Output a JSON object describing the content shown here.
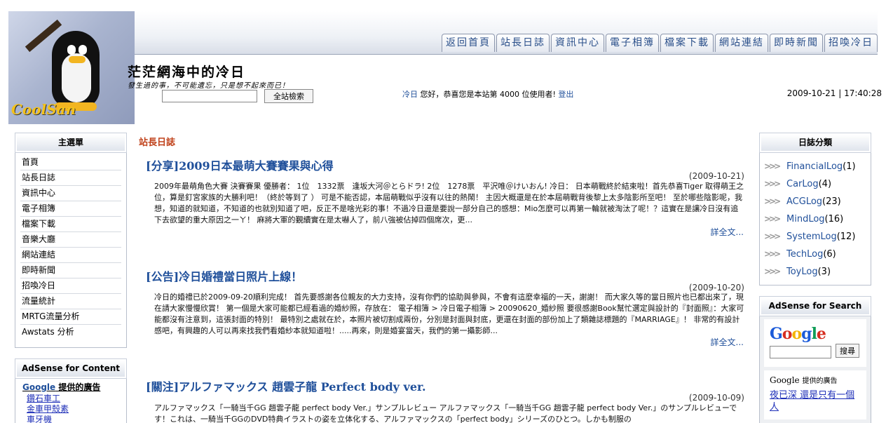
{
  "header": {
    "logo_text": "CoolSan",
    "site_title": "茫茫網海中的冷日",
    "slogan": "發生過的事，不可能遺忘，只是想不起來而已！",
    "search_button": "全站檢索",
    "greeting_user": "冷日",
    "greeting_text": "您好，恭喜您是本站第 4000 位使用者!",
    "logout": "登出",
    "datetime": "2009-10-21 | 17:40:28"
  },
  "tabs": [
    "返回首頁",
    "站長日誌",
    "資訊中心",
    "電子相簿",
    "檔案下載",
    "網站連結",
    "即時新聞",
    "招喚冷日"
  ],
  "left_menu": {
    "title": "主選單",
    "items": [
      "首頁",
      "站長日誌",
      "資訊中心",
      "電子相簿",
      "檔案下載",
      "音樂大廳",
      "網站連結",
      "即時新聞",
      "招喚冷日",
      "流量統計",
      "MRTG流量分析",
      "Awstats 分析"
    ]
  },
  "left_ads": {
    "title": "AdSense for Content",
    "provider_prefix": "Google",
    "provider_suffix": "提供的廣告",
    "links": [
      "鑽石車工",
      "金車甲殼素",
      "車牙機"
    ]
  },
  "main": {
    "section_title": "站長日誌",
    "more_label": "詳全文...",
    "posts": [
      {
        "title": "[分享]2009日本最萌大賽賽果與心得",
        "date": "(2009-10-21)",
        "body": "2009年最萌角色大賽 決賽賽果 優勝者： 1位　1332票　逢坂大河＠とらドラ! 2位　1278票　平沢唯＠けいおん! 冷日： 日本萌戰終於結束啦！首先恭喜Tiger 取得萌王之位，算是釘宮家族的大勝利吧！（終於等到了 ） 可是不能否認，本屆萌戰似乎沒有以往的熱鬧！ 主因大概還是在於本屆萌戰背後黎上太多陰影所至吧！ 至於哪些陰影呢，我想，知道的就知道，不知道的也就別知道了吧，反正不是啥光彩的事！不過冷日還是要說一部分自己的感想：Mio怎麼可以再第一輪就被淘汰了呢！？這實在是讓冷日沒有追下去欲望的重大原因之一ㄚ！ 麻將大軍的覲續實在是太嚇人了，前八強被佔掉四個席次，更..."
      },
      {
        "title": "[公告]冷日婚禮當日照片上線！",
        "date": "(2009-10-20)",
        "body": "冷日的婚禮已於2009-09-20順利完成！ 首先要感謝各位親友的大力支持，沒有你們的協助與參與，不會有這麼幸福的一天，謝謝！ 而大家久等的當日照片也已都出來了，現在請大家慢慢欣賞！ 第一個是大家可能都已經看過的婚紗照，存放在： 電子相簿 > 冷日電子相簿 > 20090620_婚紗照 要很感謝Book幫忙選定與設計的『封面照』：大家可能都沒有注意到，這張封面的特別！ 最特別之處就在於，本照片被切割成兩份，分別是封面與封底，更還在封面的部份加上了類雜誌標題的『MARRIAGE』！ 非常的有設計感吧，有興趣的人可以再來找我們看婚紗本就知道啦！.....再來，則是婚宴當天，我們的第一攝影師..."
      },
      {
        "title": "[關注]アルファマックス 趙雲子龍 Perfect body ver.",
        "date": "(2009-10-09)",
        "body": "アルファマックス「一騎当千GG 趙雲子龍 perfect body Ver.」サンプルレビュー アルファマックス「一騎当千GG 趙雲子龍 perfect body Ver.」のサンプルレビューです！これは、一騎当千GGのDVD特典イラストの姿を立体化する、アルファマックスの「perfect body」シリーズのひとつ。しかも制服の"
      }
    ]
  },
  "right_categories": {
    "title": "日誌分類",
    "items": [
      {
        "name": "FinancialLog",
        "count": "(1)"
      },
      {
        "name": "CarLog",
        "count": "(4)"
      },
      {
        "name": "ACGLog",
        "count": "(23)"
      },
      {
        "name": "MindLog",
        "count": "(16)"
      },
      {
        "name": "SystemLog",
        "count": "(12)"
      },
      {
        "name": "TechLog",
        "count": "(6)"
      },
      {
        "name": "ToyLog",
        "count": "(3)"
      }
    ]
  },
  "right_search": {
    "title": "AdSense for Search",
    "logo": "Google",
    "button": "搜尋"
  },
  "right_ads": {
    "provider_prefix": "Google",
    "provider_suffix": "提供的廣告",
    "link": "夜已深 還是只有一個人"
  },
  "colors": {
    "link": "#1f4f9a",
    "section_title": "#c0421b",
    "tab_text": "#2a4f8a"
  }
}
